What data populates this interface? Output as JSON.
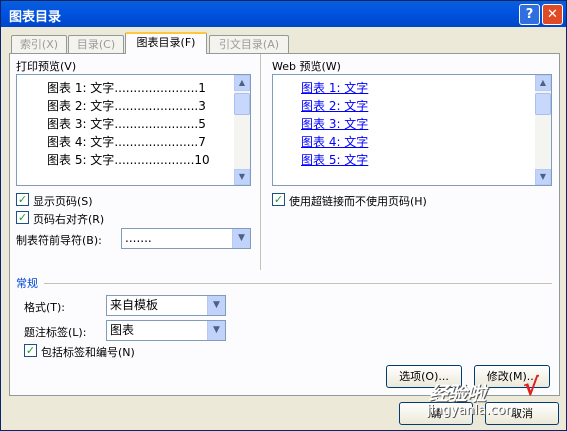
{
  "window": {
    "title": "图表目录",
    "help_label": "?",
    "close_label": "✕"
  },
  "tabs": [
    {
      "label": "索引(X)",
      "active": false
    },
    {
      "label": "目录(C)",
      "active": false
    },
    {
      "label": "图表目录(F)",
      "active": true
    },
    {
      "label": "引文目录(A)",
      "active": false
    }
  ],
  "print_preview": {
    "label": "打印预览(V)",
    "entries": [
      {
        "text": "图表  1: 文字",
        "dots": "......................",
        "page": "1"
      },
      {
        "text": "图表  2: 文字",
        "dots": "......................",
        "page": "3"
      },
      {
        "text": "图表  3: 文字",
        "dots": "......................",
        "page": "5"
      },
      {
        "text": "图表  4: 文字",
        "dots": "......................",
        "page": "7"
      },
      {
        "text": "图表  5: 文字",
        "dots": ".....................",
        "page": "10"
      }
    ]
  },
  "web_preview": {
    "label": "Web 预览(W)",
    "entries": [
      "图表  1: 文字",
      "图表  2: 文字",
      "图表  3: 文字",
      "图表  4: 文字",
      "图表  5: 文字"
    ]
  },
  "options_left": {
    "show_page_numbers": {
      "label": "显示页码(S)",
      "checked": true
    },
    "right_align": {
      "label": "页码右对齐(R)",
      "checked": true
    },
    "tab_leader": {
      "label": "制表符前导符(B):",
      "value": "......."
    }
  },
  "options_right": {
    "use_hyperlinks": {
      "label": "使用超链接而不使用页码(H)",
      "checked": true
    }
  },
  "general": {
    "heading": "常规",
    "format": {
      "label": "格式(T):",
      "value": "来自模板"
    },
    "caption_label": {
      "label": "题注标签(L):",
      "value": "图表"
    },
    "include_label": {
      "label": "包括标签和编号(N)",
      "checked": true
    }
  },
  "buttons": {
    "options": "选项(O)...",
    "modify": "修改(M)...",
    "ok": "确",
    "cancel": "取消"
  },
  "watermark": {
    "text": "经验啦",
    "url": "jingyanla.com",
    "check": "√"
  }
}
